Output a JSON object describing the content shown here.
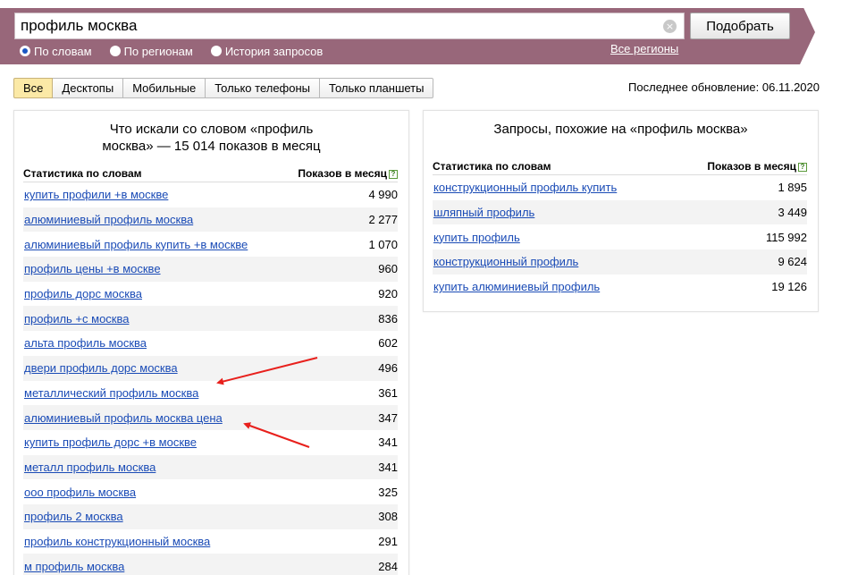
{
  "search": {
    "query": "профиль москва",
    "submit_label": "Подобрать"
  },
  "modes": [
    {
      "label": "По словам",
      "checked": true
    },
    {
      "label": "По регионам",
      "checked": false
    },
    {
      "label": "История запросов",
      "checked": false
    }
  ],
  "regions_link": "Все регионы",
  "tabs": [
    {
      "label": "Все",
      "active": true
    },
    {
      "label": "Десктопы",
      "active": false
    },
    {
      "label": "Мобильные",
      "active": false
    },
    {
      "label": "Только телефоны",
      "active": false
    },
    {
      "label": "Только планшеты",
      "active": false
    }
  ],
  "last_update": "Последнее обновление: 06.11.2020",
  "left_panel": {
    "title_line1": "Что искали со словом «профиль",
    "title_line2": "москва» — 15 014 показов в месяц",
    "col_keyword": "Статистика по словам",
    "col_count": "Показов в месяц",
    "rows": [
      {
        "keyword": "купить профили +в москве",
        "count": "4 990"
      },
      {
        "keyword": "алюминиевый профиль москва",
        "count": "2 277"
      },
      {
        "keyword": "алюминиевый профиль купить +в москве",
        "count": "1 070"
      },
      {
        "keyword": "профиль цены +в москве",
        "count": "960"
      },
      {
        "keyword": "профиль дорс москва",
        "count": "920"
      },
      {
        "keyword": "профиль +с москва",
        "count": "836"
      },
      {
        "keyword": "альта профиль москва",
        "count": "602"
      },
      {
        "keyword": "двери профиль дорс москва",
        "count": "496"
      },
      {
        "keyword": "металлический профиль москва",
        "count": "361"
      },
      {
        "keyword": "алюминиевый профиль москва цена",
        "count": "347"
      },
      {
        "keyword": "купить профиль дорс +в москве",
        "count": "341"
      },
      {
        "keyword": "металл профиль москва",
        "count": "341"
      },
      {
        "keyword": "ооо профиль москва",
        "count": "325"
      },
      {
        "keyword": "профиль 2 москва",
        "count": "308"
      },
      {
        "keyword": "профиль конструкционный москва",
        "count": "291"
      },
      {
        "keyword": "м профиль москва",
        "count": "284"
      }
    ]
  },
  "right_panel": {
    "title": "Запросы, похожие на «профиль москва»",
    "col_keyword": "Статистика по словам",
    "col_count": "Показов в месяц",
    "rows": [
      {
        "keyword": "конструкционный профиль купить",
        "count": "1 895"
      },
      {
        "keyword": "шляпный профиль",
        "count": "3 449"
      },
      {
        "keyword": "купить профиль",
        "count": "115 992"
      },
      {
        "keyword": "конструкционный профиль",
        "count": "9 624"
      },
      {
        "keyword": "купить алюминиевый профиль",
        "count": "19 126"
      }
    ]
  },
  "colors": {
    "header_band": "#98677a",
    "link": "#1a4bb6",
    "active_tab": "#fbe9a6",
    "annotation_arrow": "#e8201c"
  }
}
